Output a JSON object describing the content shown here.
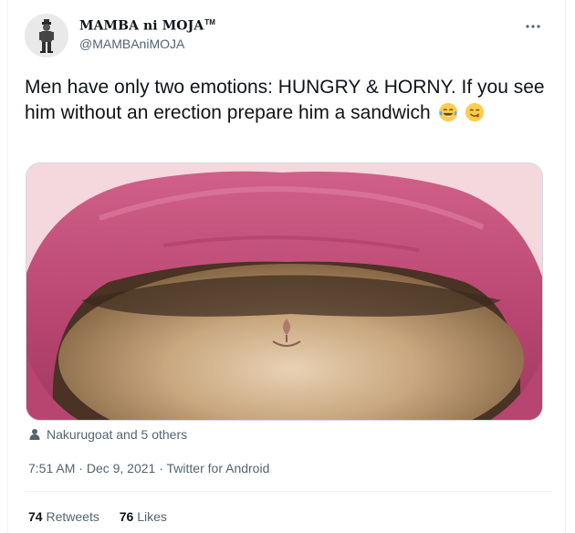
{
  "tweet": {
    "author": {
      "display_name": "MAMBA ni MOJA",
      "trademark": "TM",
      "handle": "@MAMBAniMOJA"
    },
    "text": "Men have only two emotions: HUNGRY & HORNY. If you see him without an erection prepare him a sandwich",
    "emojis": [
      "tears-of-joy-emoji",
      "savoring-food-emoji"
    ],
    "media": {
      "description": "photo of a cat's face inside a pink hood",
      "colors": {
        "hood": "#c24e78",
        "fur": "#c9a77f",
        "background": "#f6dde2"
      }
    },
    "tagged_people": "Nakurugoat and 5 others",
    "time": "7:51 AM",
    "separator": "·",
    "date": "Dec 9, 2021",
    "source": "Twitter for Android",
    "retweets_count": "74",
    "retweets_label": "Retweets",
    "likes_count": "76",
    "likes_label": "Likes"
  },
  "colors": {
    "text_primary": "#0f1419",
    "text_secondary": "#536471",
    "border": "#cfd9de"
  }
}
